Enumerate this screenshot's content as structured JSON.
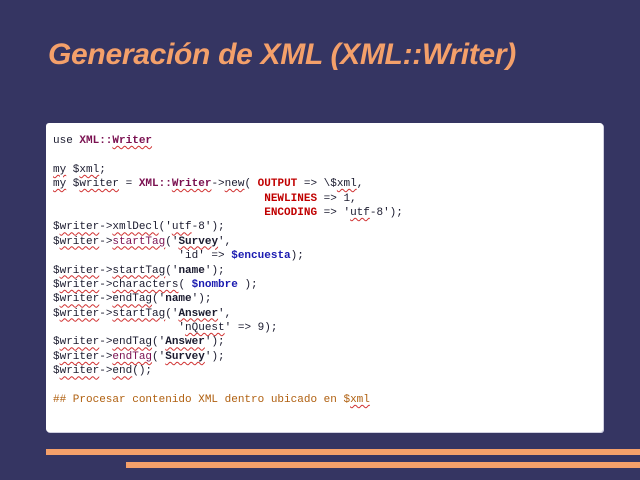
{
  "slide": {
    "title": "Generación de XML (XML::Writer)",
    "colors": {
      "background": "#353562",
      "title": "#f4a06a",
      "accent_bars": "#f4a06a",
      "code_panel": "#ffffff",
      "keyword_red": "#c00000",
      "module_purple": "#7a1050",
      "variable_blue": "#1a1ab0",
      "comment": "#b06010"
    }
  },
  "code": {
    "lines": [
      [
        {
          "t": "use ",
          "c": "tok-var"
        },
        {
          "t": "XML::",
          "c": "tok-mod"
        },
        {
          "t": "Writer",
          "c": "tok-mod sq"
        }
      ],
      [],
      [
        {
          "t": "my",
          "c": "tok-var sq"
        },
        {
          "t": " $",
          "c": "tok-var"
        },
        {
          "t": "xml",
          "c": "tok-var sq"
        },
        {
          "t": ";",
          "c": "tok-var"
        }
      ],
      [
        {
          "t": "my",
          "c": "tok-var sq"
        },
        {
          "t": " $",
          "c": "tok-var"
        },
        {
          "t": "writer",
          "c": "tok-var sq"
        },
        {
          "t": " = ",
          "c": "tok-var"
        },
        {
          "t": "XML::",
          "c": "tok-mod"
        },
        {
          "t": "Writer",
          "c": "tok-mod sq"
        },
        {
          "t": "->",
          "c": "tok-var"
        },
        {
          "t": "new",
          "c": "tok-var sq"
        },
        {
          "t": "( ",
          "c": "tok-var"
        },
        {
          "t": "OUTPUT",
          "c": "tok-key"
        },
        {
          "t": " => \\$",
          "c": "tok-var"
        },
        {
          "t": "xml",
          "c": "tok-var sq"
        },
        {
          "t": ",",
          "c": "tok-var"
        }
      ],
      [
        {
          "t": "                                ",
          "c": "tok-var"
        },
        {
          "t": "NEWLINES",
          "c": "tok-key"
        },
        {
          "t": " => 1,",
          "c": "tok-var"
        }
      ],
      [
        {
          "t": "                                ",
          "c": "tok-var"
        },
        {
          "t": "ENCODING",
          "c": "tok-key"
        },
        {
          "t": " => '",
          "c": "tok-var"
        },
        {
          "t": "utf",
          "c": "tok-var sq"
        },
        {
          "t": "-8');",
          "c": "tok-var"
        }
      ],
      [
        {
          "t": "$",
          "c": "tok-var"
        },
        {
          "t": "writer",
          "c": "tok-var sq"
        },
        {
          "t": "->",
          "c": "tok-var"
        },
        {
          "t": "xmlDecl",
          "c": "tok-var sq"
        },
        {
          "t": "('",
          "c": "tok-var"
        },
        {
          "t": "utf",
          "c": "tok-var sq"
        },
        {
          "t": "-8');",
          "c": "tok-var"
        }
      ],
      [
        {
          "t": "$",
          "c": "tok-var"
        },
        {
          "t": "writer",
          "c": "tok-var sq"
        },
        {
          "t": "->",
          "c": "tok-var"
        },
        {
          "t": "startTag",
          "c": "tok-link sq"
        },
        {
          "t": "('",
          "c": "tok-var"
        },
        {
          "t": "Survey",
          "c": "tok-b sq"
        },
        {
          "t": "',",
          "c": "tok-var"
        }
      ],
      [
        {
          "t": "                   'id' => ",
          "c": "tok-var"
        },
        {
          "t": "$encuesta",
          "c": "tok-blue"
        },
        {
          "t": ");",
          "c": "tok-var"
        }
      ],
      [
        {
          "t": "$",
          "c": "tok-var"
        },
        {
          "t": "writer",
          "c": "tok-var sq"
        },
        {
          "t": "->",
          "c": "tok-var"
        },
        {
          "t": "startTag",
          "c": "tok-var sq"
        },
        {
          "t": "('",
          "c": "tok-var"
        },
        {
          "t": "name",
          "c": "tok-b"
        },
        {
          "t": "');",
          "c": "tok-var"
        }
      ],
      [
        {
          "t": "$",
          "c": "tok-var"
        },
        {
          "t": "writer",
          "c": "tok-var sq"
        },
        {
          "t": "->",
          "c": "tok-var"
        },
        {
          "t": "characters",
          "c": "tok-var sq"
        },
        {
          "t": "( ",
          "c": "tok-var"
        },
        {
          "t": "$nombre",
          "c": "tok-blue"
        },
        {
          "t": " );",
          "c": "tok-var"
        }
      ],
      [
        {
          "t": "$",
          "c": "tok-var"
        },
        {
          "t": "writer",
          "c": "tok-var sq"
        },
        {
          "t": "->",
          "c": "tok-var"
        },
        {
          "t": "endTag",
          "c": "tok-var sq"
        },
        {
          "t": "('",
          "c": "tok-var"
        },
        {
          "t": "name",
          "c": "tok-b"
        },
        {
          "t": "');",
          "c": "tok-var"
        }
      ],
      [
        {
          "t": "$",
          "c": "tok-var"
        },
        {
          "t": "writer",
          "c": "tok-var sq"
        },
        {
          "t": "->",
          "c": "tok-var"
        },
        {
          "t": "startTag",
          "c": "tok-var sq"
        },
        {
          "t": "('",
          "c": "tok-var"
        },
        {
          "t": "Answer",
          "c": "tok-b sq"
        },
        {
          "t": "',",
          "c": "tok-var"
        }
      ],
      [
        {
          "t": "                   '",
          "c": "tok-var"
        },
        {
          "t": "nQuest",
          "c": "tok-var sq"
        },
        {
          "t": "' => 9);",
          "c": "tok-var"
        }
      ],
      [
        {
          "t": "$",
          "c": "tok-var"
        },
        {
          "t": "writer",
          "c": "tok-var sq"
        },
        {
          "t": "->",
          "c": "tok-var"
        },
        {
          "t": "endTag",
          "c": "tok-var sq"
        },
        {
          "t": "('",
          "c": "tok-var"
        },
        {
          "t": "Answer",
          "c": "tok-b sq"
        },
        {
          "t": "');",
          "c": "tok-var"
        }
      ],
      [
        {
          "t": "$",
          "c": "tok-var"
        },
        {
          "t": "writer",
          "c": "tok-var sq"
        },
        {
          "t": "->",
          "c": "tok-var"
        },
        {
          "t": "endTag",
          "c": "tok-link sq"
        },
        {
          "t": "('",
          "c": "tok-var"
        },
        {
          "t": "Survey",
          "c": "tok-b sq"
        },
        {
          "t": "');",
          "c": "tok-var"
        }
      ],
      [
        {
          "t": "$",
          "c": "tok-var"
        },
        {
          "t": "writer",
          "c": "tok-var sq"
        },
        {
          "t": "->",
          "c": "tok-var"
        },
        {
          "t": "end",
          "c": "tok-var sq"
        },
        {
          "t": "();",
          "c": "tok-var"
        }
      ],
      [],
      [
        {
          "t": "## Procesar contenido XML dentro ubicado en $",
          "c": "tok-com"
        },
        {
          "t": "xml",
          "c": "tok-com sq"
        }
      ]
    ]
  }
}
